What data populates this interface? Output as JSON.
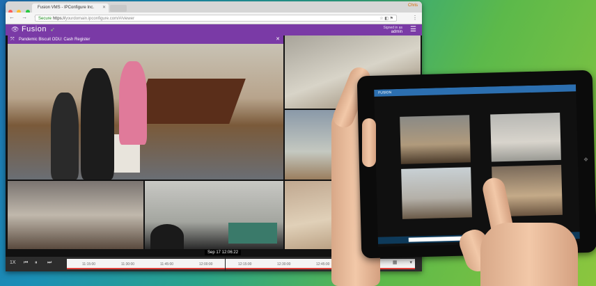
{
  "browser": {
    "tab_title": "Fusion VMS - IPConfigure Inc.",
    "user_chip": "Chris",
    "secure_label": "Secure",
    "url": "https://",
    "url_host": "yourdomain.ipconfigure.com/#/viewer",
    "url_icons": "☆  ◧  ⚑",
    "nav_buttons": "← → ⟳",
    "menu_dots": "⋮"
  },
  "app": {
    "logo_text": "Fusion",
    "signed_in_label": "Signed in as",
    "signed_in_user": "admin"
  },
  "main_camera": {
    "title": "Pandemic Biscuit ODU: Cash Register"
  },
  "timeline": {
    "current_time": "Sep 17 12:06:22",
    "live_label": "1X",
    "ticks": [
      "11:15:00",
      "11:30:00",
      "11:45:00",
      "12:00:00",
      "12:15:00",
      "12:30:00",
      "12:45:00"
    ],
    "right_icons": "^  ▦  ▾"
  },
  "tablet": {
    "app_title": "FUSION"
  },
  "colors": {
    "app_purple": "#7a3aa6",
    "timeline_red": "#e0403a",
    "tablet_blue": "#2c6fb0"
  }
}
